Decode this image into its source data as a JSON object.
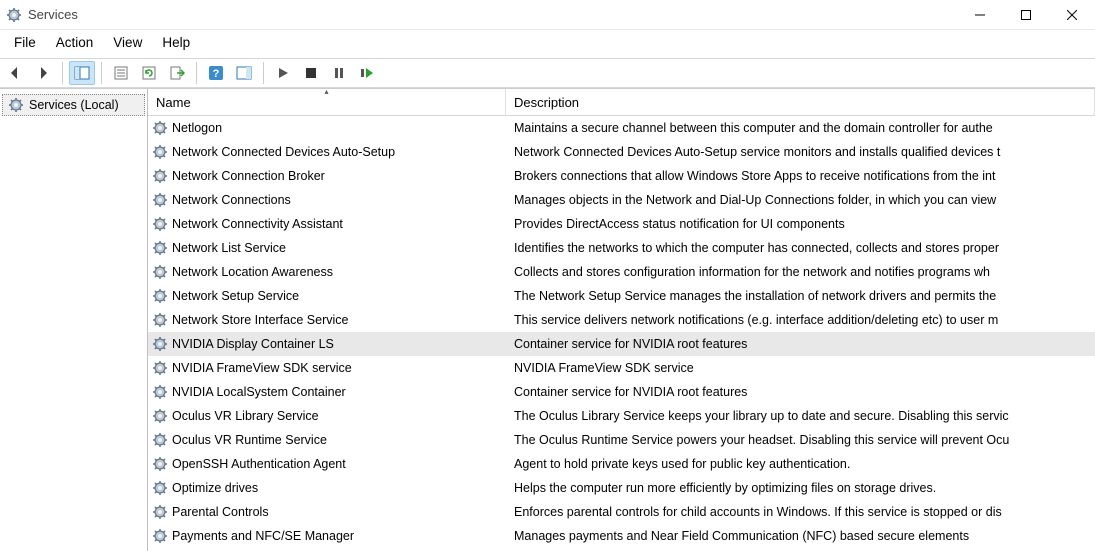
{
  "window": {
    "title": "Services"
  },
  "menu": {
    "items": [
      "File",
      "Action",
      "View",
      "Help"
    ]
  },
  "toolbar": {
    "buttons": [
      {
        "name": "back-icon"
      },
      {
        "name": "forward-icon"
      },
      {
        "name": "show-hide-tree-icon",
        "selected": true
      },
      {
        "name": "properties-icon"
      },
      {
        "name": "refresh-icon"
      },
      {
        "name": "export-list-icon"
      },
      {
        "name": "help-icon"
      },
      {
        "name": "action-pane-icon"
      },
      {
        "name": "start-icon"
      },
      {
        "name": "stop-icon"
      },
      {
        "name": "pause-icon"
      },
      {
        "name": "restart-icon"
      }
    ]
  },
  "tree": {
    "items": [
      {
        "label": "Services (Local)"
      }
    ]
  },
  "columns": {
    "name": "Name",
    "description": "Description",
    "sort_indicator": "▴"
  },
  "services": [
    {
      "name": "Netlogon",
      "desc": "Maintains a secure channel between this computer and the domain controller for authe"
    },
    {
      "name": "Network Connected Devices Auto-Setup",
      "desc": "Network Connected Devices Auto-Setup service monitors and installs qualified devices t"
    },
    {
      "name": "Network Connection Broker",
      "desc": "Brokers connections that allow Windows Store Apps to receive notifications from the int"
    },
    {
      "name": "Network Connections",
      "desc": "Manages objects in the Network and Dial-Up Connections folder, in which you can view"
    },
    {
      "name": "Network Connectivity Assistant",
      "desc": "Provides DirectAccess status notification for UI components"
    },
    {
      "name": "Network List Service",
      "desc": "Identifies the networks to which the computer has connected, collects and stores proper"
    },
    {
      "name": "Network Location Awareness",
      "desc": "Collects and stores configuration information for the network and notifies programs wh"
    },
    {
      "name": "Network Setup Service",
      "desc": "The Network Setup Service manages the installation of network drivers and permits the"
    },
    {
      "name": "Network Store Interface Service",
      "desc": "This service delivers network notifications (e.g. interface addition/deleting etc) to user m"
    },
    {
      "name": "NVIDIA Display Container LS",
      "desc": "Container service for NVIDIA root features",
      "selected": true
    },
    {
      "name": "NVIDIA FrameView SDK service",
      "desc": "NVIDIA FrameView SDK service"
    },
    {
      "name": "NVIDIA LocalSystem Container",
      "desc": "Container service for NVIDIA root features"
    },
    {
      "name": "Oculus VR Library Service",
      "desc": "The Oculus Library Service keeps your library up to date and secure. Disabling this servic"
    },
    {
      "name": "Oculus VR Runtime Service",
      "desc": "The Oculus Runtime Service powers your headset. Disabling this service will prevent Ocu"
    },
    {
      "name": "OpenSSH Authentication Agent",
      "desc": "Agent to hold private keys used for public key authentication."
    },
    {
      "name": "Optimize drives",
      "desc": "Helps the computer run more efficiently by optimizing files on storage drives."
    },
    {
      "name": "Parental Controls",
      "desc": "Enforces parental controls for child accounts in Windows. If this service is stopped or dis"
    },
    {
      "name": "Payments and NFC/SE Manager",
      "desc": "Manages payments and Near Field Communication (NFC) based secure elements"
    }
  ]
}
